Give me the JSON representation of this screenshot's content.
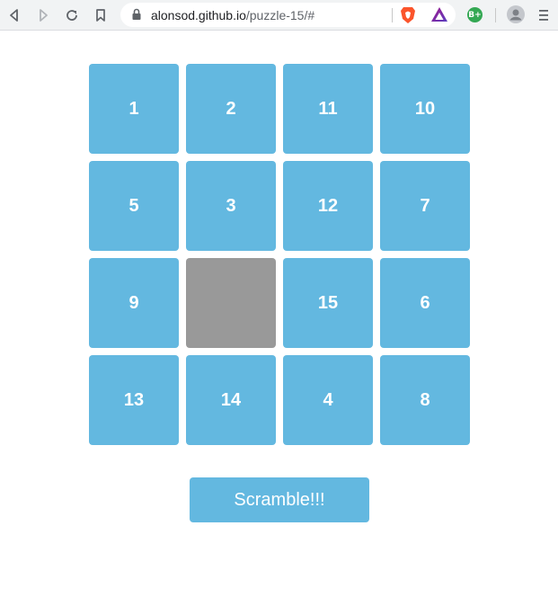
{
  "browser": {
    "url_host": "alonsod.github.io",
    "url_path": "/puzzle-15/#",
    "extension_badge": "B+"
  },
  "icons": {
    "back": "back-arrow-icon",
    "forward": "forward-arrow-icon",
    "reload": "reload-icon",
    "bookmark": "bookmark-icon",
    "lock": "lock-icon",
    "brave": "brave-shield-icon",
    "rewards": "brave-rewards-icon",
    "profile": "profile-avatar-icon",
    "menu": "hamburger-menu-icon"
  },
  "puzzle": {
    "tiles": [
      {
        "label": "1",
        "row": 0,
        "col": 0
      },
      {
        "label": "2",
        "row": 0,
        "col": 1
      },
      {
        "label": "11",
        "row": 0,
        "col": 2
      },
      {
        "label": "10",
        "row": 0,
        "col": 3
      },
      {
        "label": "5",
        "row": 1,
        "col": 0
      },
      {
        "label": "3",
        "row": 1,
        "col": 1
      },
      {
        "label": "12",
        "row": 1,
        "col": 2
      },
      {
        "label": "7",
        "row": 1,
        "col": 3
      },
      {
        "label": "9",
        "row": 2,
        "col": 0
      },
      {
        "label": "",
        "row": 2,
        "col": 1,
        "empty": true
      },
      {
        "label": "15",
        "row": 2,
        "col": 2
      },
      {
        "label": "6",
        "row": 2,
        "col": 3
      },
      {
        "label": "13",
        "row": 3,
        "col": 0
      },
      {
        "label": "14",
        "row": 3,
        "col": 1
      },
      {
        "label": "4",
        "row": 3,
        "col": 2
      },
      {
        "label": "8",
        "row": 3,
        "col": 3
      }
    ],
    "scramble_label": "Scramble!!!"
  },
  "colors": {
    "tile": "#63b8e0",
    "empty_tile": "#999999",
    "tile_text": "#ffffff"
  }
}
